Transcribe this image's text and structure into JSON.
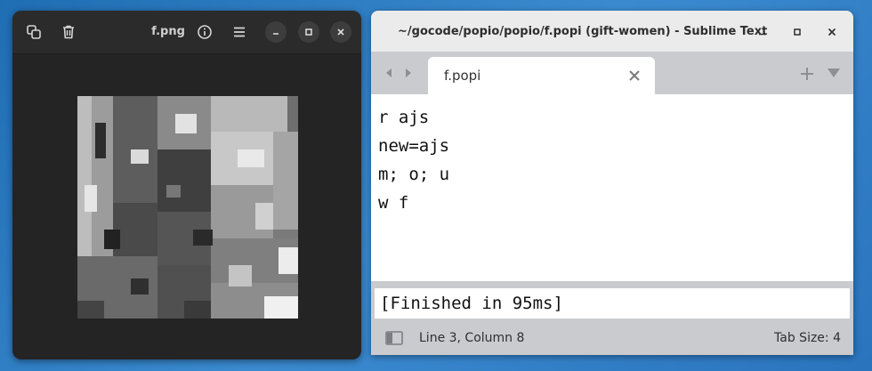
{
  "viewer": {
    "title": "f.png",
    "toolbar": [
      "copy-icon",
      "trash-icon",
      "info-icon",
      "hamburger-menu-icon"
    ],
    "window_controls": [
      "minimize",
      "maximize",
      "close"
    ]
  },
  "sublime": {
    "title": "~/gocode/popio/popio/f.popi (gift-women) - Sublime Text",
    "tab": {
      "label": "f.popi"
    },
    "code_lines": [
      "r ajs",
      "new=ajs",
      "m; o; u",
      "w f"
    ],
    "build_output": "[Finished in 95ms]",
    "status": {
      "position": "Line 3, Column 8",
      "tab_size": "Tab Size: 4"
    }
  }
}
